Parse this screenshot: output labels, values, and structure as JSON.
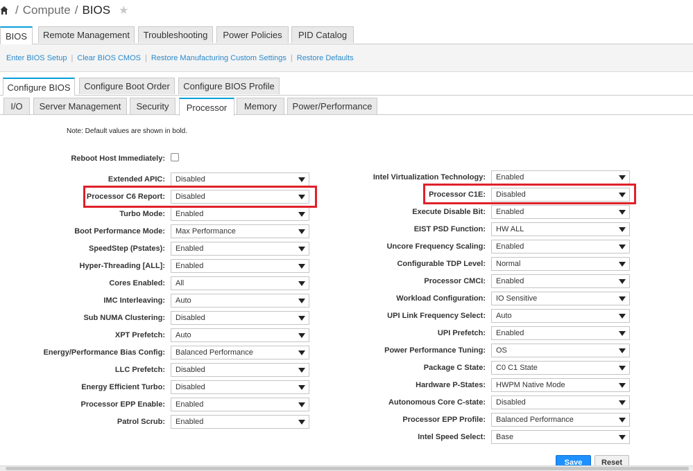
{
  "breadcrumb": {
    "part1": "Compute",
    "separator": "/",
    "current": "BIOS"
  },
  "top_tabs": [
    "BIOS",
    "Remote Management",
    "Troubleshooting",
    "Power Policies",
    "PID Catalog"
  ],
  "actions": [
    "Enter BIOS Setup",
    "Clear BIOS CMOS",
    "Restore Manufacturing Custom Settings",
    "Restore Defaults"
  ],
  "bios_tabs": [
    "Configure BIOS",
    "Configure Boot Order",
    "Configure BIOS Profile"
  ],
  "sub_tabs": [
    "I/O",
    "Server Management",
    "Security",
    "Processor",
    "Memory",
    "Power/Performance"
  ],
  "note": "Note: Default values are shown in bold.",
  "reboot_label": "Reboot Host Immediately:",
  "left": [
    {
      "label": "Extended APIC:",
      "value": "Disabled"
    },
    {
      "label": "Processor C6 Report:",
      "value": "Disabled"
    },
    {
      "label": "Turbo Mode:",
      "value": "Enabled"
    },
    {
      "label": "Boot Performance Mode:",
      "value": "Max Performance"
    },
    {
      "label": "SpeedStep (Pstates):",
      "value": "Enabled"
    },
    {
      "label": "Hyper-Threading [ALL]:",
      "value": "Enabled"
    },
    {
      "label": "Cores Enabled:",
      "value": "All"
    },
    {
      "label": "IMC Interleaving:",
      "value": "Auto"
    },
    {
      "label": "Sub NUMA Clustering:",
      "value": "Disabled"
    },
    {
      "label": "XPT Prefetch:",
      "value": "Auto"
    },
    {
      "label": "Energy/Performance Bias Config:",
      "value": "Balanced Performance"
    },
    {
      "label": "LLC Prefetch:",
      "value": "Disabled"
    },
    {
      "label": "Energy Efficient Turbo:",
      "value": "Disabled"
    },
    {
      "label": "Processor EPP Enable:",
      "value": "Enabled"
    },
    {
      "label": "Patrol Scrub:",
      "value": "Enabled"
    }
  ],
  "right": [
    {
      "label": "Intel Virtualization Technology:",
      "value": "Enabled"
    },
    {
      "label": "Processor C1E:",
      "value": "Disabled"
    },
    {
      "label": "Execute Disable Bit:",
      "value": "Enabled"
    },
    {
      "label": "EIST PSD Function:",
      "value": "HW ALL"
    },
    {
      "label": "Uncore Frequency Scaling:",
      "value": "Enabled"
    },
    {
      "label": "Configurable TDP Level:",
      "value": "Normal"
    },
    {
      "label": "Processor CMCI:",
      "value": "Enabled"
    },
    {
      "label": "Workload Configuration:",
      "value": "IO Sensitive"
    },
    {
      "label": "UPI Link Frequency Select:",
      "value": "Auto"
    },
    {
      "label": "UPI Prefetch:",
      "value": "Enabled"
    },
    {
      "label": "Power Performance Tuning:",
      "value": "OS"
    },
    {
      "label": "Package C State:",
      "value": "C0 C1 State"
    },
    {
      "label": "Hardware P-States:",
      "value": "HWPM Native Mode"
    },
    {
      "label": "Autonomous Core C-state:",
      "value": "Disabled"
    },
    {
      "label": "Processor EPP Profile:",
      "value": "Balanced Performance"
    },
    {
      "label": "Intel Speed Select:",
      "value": "Base"
    }
  ],
  "buttons": {
    "save": "Save",
    "reset": "Reset"
  },
  "colors": {
    "accent": "#049fd9",
    "link": "#2a8acb",
    "highlight": "#e0202a",
    "save_button": "#1e90ff"
  }
}
